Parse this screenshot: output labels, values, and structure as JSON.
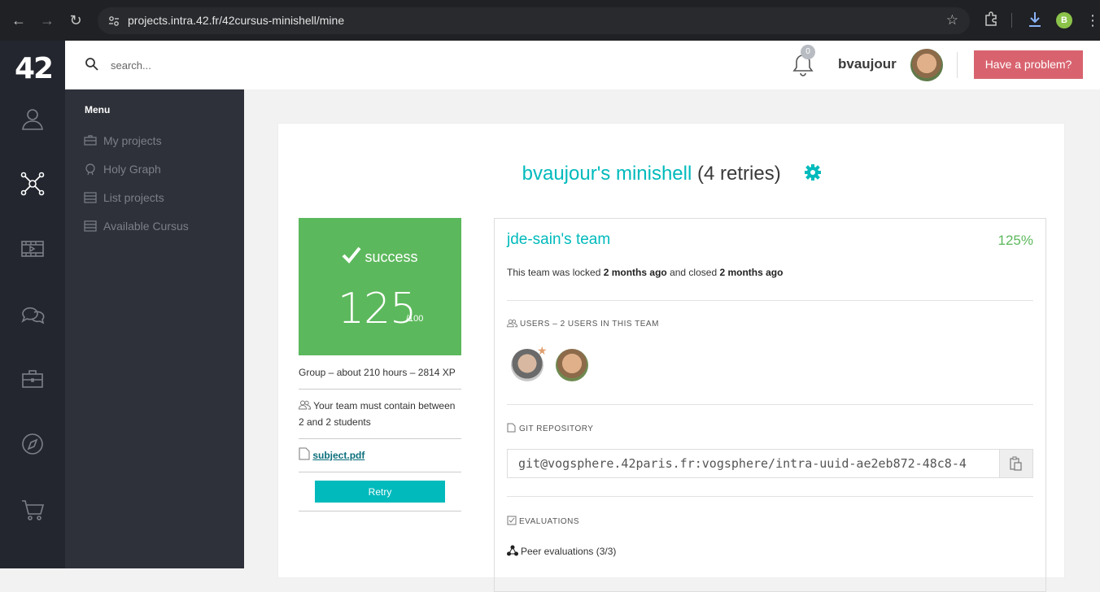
{
  "browser": {
    "url_host": "projects.intra.42.fr",
    "url_path": "/42cursus-minishell/mine",
    "profile_initial": "B"
  },
  "rail": {
    "logo": "42",
    "icons": [
      "profile-icon",
      "holy-graph-icon",
      "video-icon",
      "chat-icon",
      "briefcase-icon",
      "compass-icon",
      "cart-icon"
    ]
  },
  "menu": {
    "title": "Menu",
    "items": [
      {
        "label": "My projects",
        "icon": "briefcase-icon"
      },
      {
        "label": "Holy Graph",
        "icon": "graph-icon"
      },
      {
        "label": "List projects",
        "icon": "list-icon"
      },
      {
        "label": "Available Cursus",
        "icon": "list-icon"
      }
    ]
  },
  "header": {
    "search_placeholder": "search...",
    "notifications_count": "0",
    "username": "bvaujour",
    "problem_button": "Have a problem?"
  },
  "project": {
    "title_user": "bvaujour's minishell",
    "title_retries": "(4 retries)",
    "status": "success",
    "final_mark": "125",
    "max_mark": "/100",
    "info": "Group – about 210 hours – 2814 XP",
    "team_size": "Your team must contain between 2 and 2 students",
    "subject_link": "subject.pdf",
    "retry_button": "Retry"
  },
  "team": {
    "name": "jde-sain's team",
    "percent": "125%",
    "status_prefix": "This team was locked ",
    "locked_when": "2 months ago",
    "status_middle": " and closed ",
    "closed_when": "2 months ago",
    "users_label": "USERS – 2 USERS IN THIS TEAM",
    "git_label": "GIT REPOSITORY",
    "git_url": "git@vogsphere.42paris.fr:vogsphere/intra-uuid-ae2eb872-48c8-4",
    "evaluations_label": "EVALUATIONS",
    "peer_evaluations": "Peer evaluations (3/3)"
  },
  "colors": {
    "accent": "#00babc",
    "success": "#5cb85c",
    "problem_button": "#d8636f",
    "rail_bg": "#23262f",
    "menu_bg": "#2e3139"
  }
}
